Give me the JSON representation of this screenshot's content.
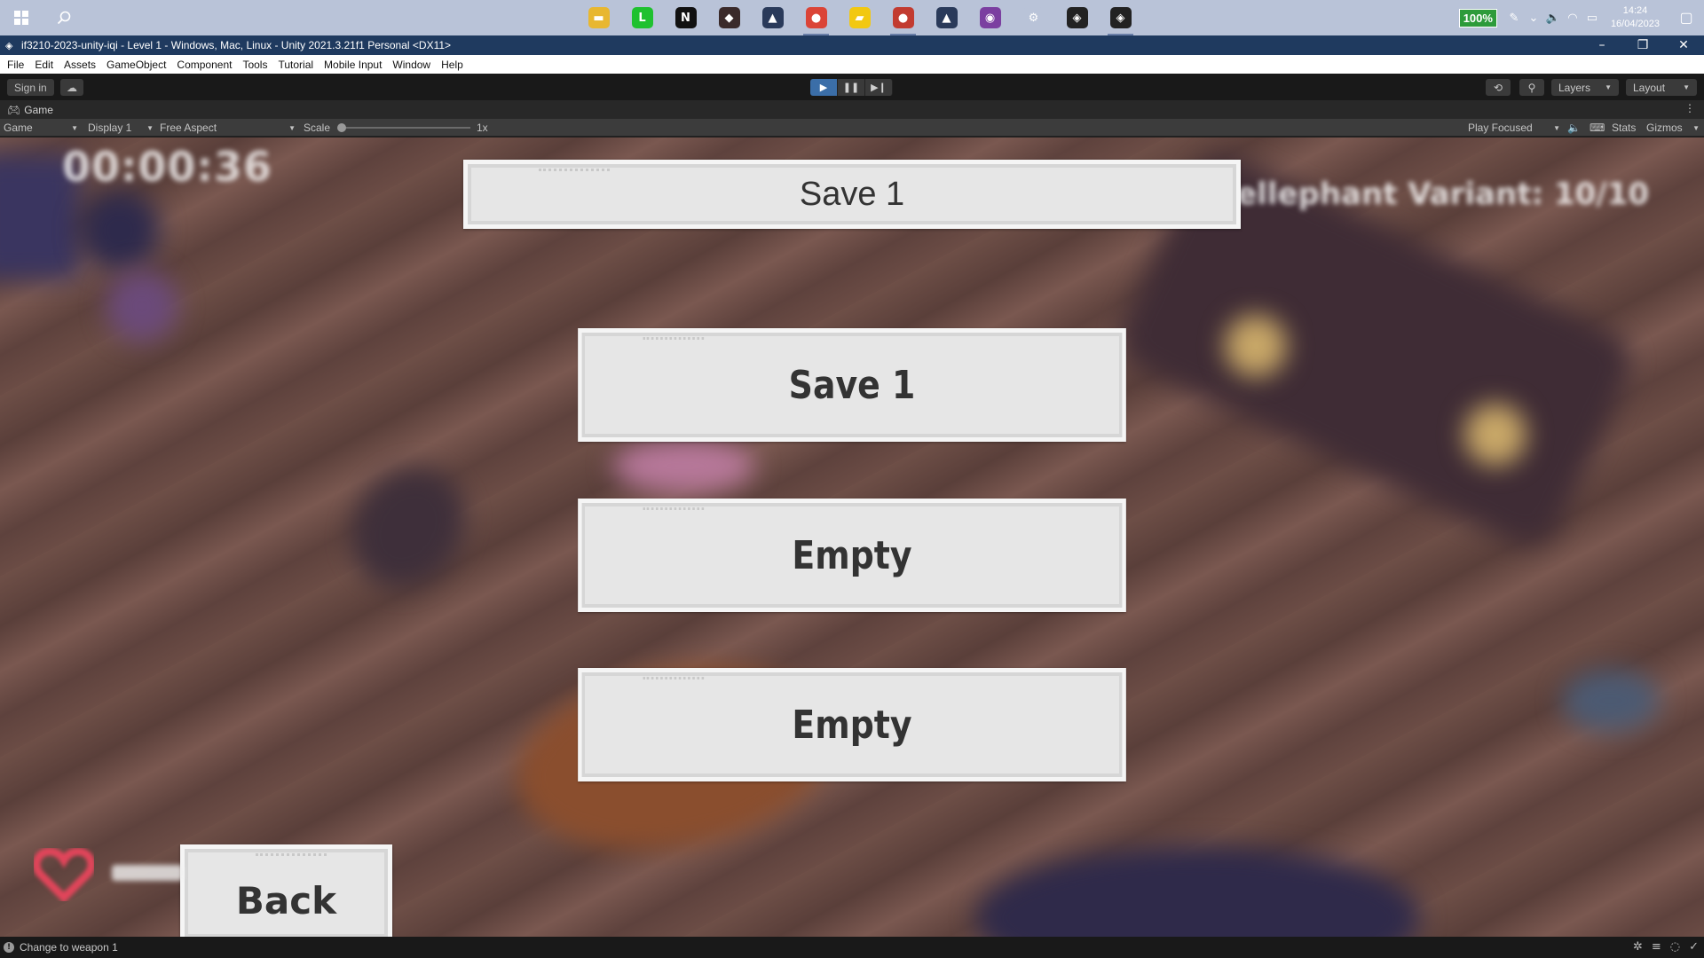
{
  "taskbar": {
    "apps": [
      {
        "name": "file-explorer-icon",
        "glyph": "▬",
        "color": "#e8b730",
        "active": false
      },
      {
        "name": "line-app-icon",
        "glyph": "L",
        "color": "#1fc12f",
        "active": false
      },
      {
        "name": "notion-icon",
        "glyph": "N",
        "color": "#111111",
        "active": false
      },
      {
        "name": "game-avatar-icon",
        "glyph": "◆",
        "color": "#3a2a2a",
        "active": false
      },
      {
        "name": "game-launcher-icon",
        "glyph": "▲",
        "color": "#2a3a5a",
        "active": false
      },
      {
        "name": "chrome-icon",
        "glyph": "●",
        "color": "#db4437",
        "active": true
      },
      {
        "name": "sticky-notes-icon",
        "glyph": "▰",
        "color": "#f2c811",
        "active": false
      },
      {
        "name": "chrome-profile-icon",
        "glyph": "●",
        "color": "#c23b30",
        "active": true
      },
      {
        "name": "game-launcher-2-icon",
        "glyph": "▲",
        "color": "#2a3a5a",
        "active": false
      },
      {
        "name": "github-desktop-icon",
        "glyph": "◉",
        "color": "#7b3fa0",
        "active": false
      },
      {
        "name": "settings-icon",
        "glyph": "⚙",
        "color": "#b9c3d8",
        "active": false
      },
      {
        "name": "unity-hub-icon",
        "glyph": "◈",
        "color": "#222222",
        "active": false
      },
      {
        "name": "unity-editor-icon",
        "glyph": "◈",
        "color": "#222222",
        "active": true
      }
    ],
    "battery": "100%",
    "time": "14:24",
    "date": "16/04/2023"
  },
  "window": {
    "title": "if3210-2023-unity-iqi - Level 1 - Windows, Mac, Linux - Unity 2021.3.21f1 Personal <DX11>"
  },
  "menu": [
    "File",
    "Edit",
    "Assets",
    "GameObject",
    "Component",
    "Tools",
    "Tutorial",
    "Mobile Input",
    "Window",
    "Help"
  ],
  "toolbar": {
    "sign_in": "Sign in",
    "layers": "Layers",
    "layout": "Layout"
  },
  "game_view": {
    "tab": "Game",
    "mode": "Game",
    "display": "Display 1",
    "aspect": "Free Aspect",
    "scale_label": "Scale",
    "scale_value": "1x",
    "play_focused": "Play Focused",
    "stats": "Stats",
    "gizmos": "Gizmos"
  },
  "game": {
    "timer": "00:00:36",
    "variant_counter": "Hellephant Variant: 10/10",
    "title": "Save 1",
    "slots": [
      "Save 1",
      "Empty",
      "Empty"
    ],
    "back": "Back",
    "health_color": "#e0455a"
  },
  "status": {
    "message": "Change to weapon 1"
  },
  "colors": {
    "play_active": "#3b6ea8",
    "title_bar": "#1f3a5f",
    "panel": "#e6e6e6"
  }
}
